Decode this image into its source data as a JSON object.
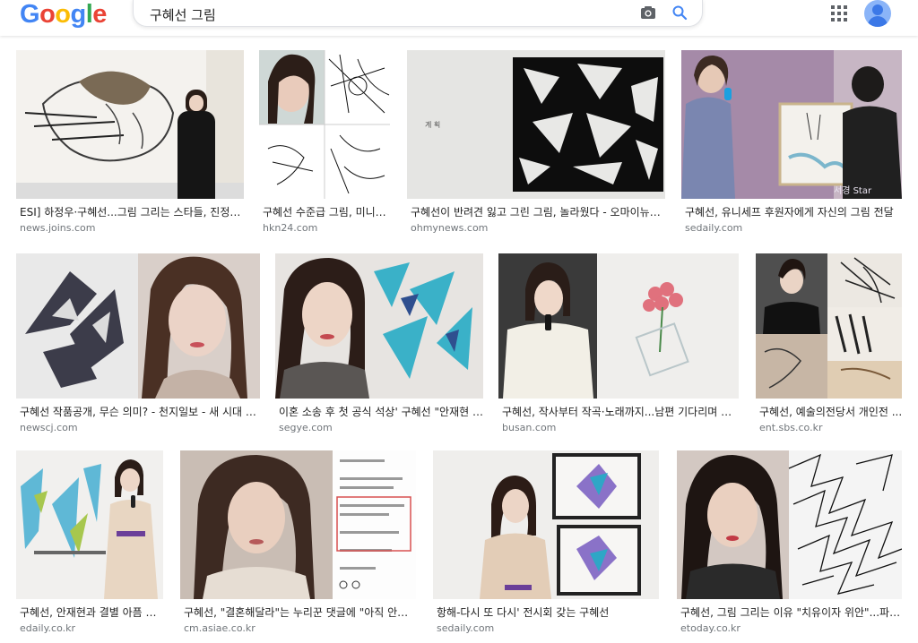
{
  "header": {
    "logo": [
      "G",
      "o",
      "o",
      "g",
      "l",
      "e"
    ],
    "logo_colors": [
      "#4285F4",
      "#EA4335",
      "#FBBC05",
      "#4285F4",
      "#34A853",
      "#EA4335"
    ],
    "search_query": "구혜선 그림",
    "icons": [
      "camera-icon",
      "search-icon",
      "apps-grid-icon",
      "account-avatar-icon"
    ]
  },
  "results": [
    {
      "title": "ESI] 하정우·구혜선...그림 그리는 스타들, 진정 실...",
      "domain": "news.joins.com"
    },
    {
      "title": "구혜선 수준급 그림, 미니홈...",
      "domain": "hkn24.com"
    },
    {
      "title": "구혜선이 반려견 잃고 그린 그림, 놀라웠다 - 오마이뉴스 ...",
      "domain": "ohmynews.com"
    },
    {
      "title": "구혜선, 유니세프 후원자에게 자신의 그림 전달",
      "domain": "sedaily.com"
    },
    {
      "title": "구혜선 작품공개, 무슨 의미? - 천지일보 - 새 시대 희망...",
      "domain": "newscj.com"
    },
    {
      "title": "이혼 소송 후 첫 공식 석상' 구혜선 \"안재현 잊...",
      "domain": "segye.com"
    },
    {
      "title": "구혜선, 작사부터 작곡·노래까지...남편 기다리며 만든 ...",
      "domain": "busan.com"
    },
    {
      "title": "구혜선, 예술의전당서 개인전 ...",
      "domain": "ent.sbs.co.kr"
    },
    {
      "title": "구혜선, 안재현과 결별 아픔 딛...",
      "domain": "edaily.co.kr"
    },
    {
      "title": "구혜선, \"결혼해달라\"는 누리꾼 댓글에 \"아직 안돼\" - ...",
      "domain": "cm.asiae.co.kr"
    },
    {
      "title": "항해-다시 또 다시' 전시회 갖는 구혜선",
      "domain": "sedaily.com"
    },
    {
      "title": "구혜선, 그림 그리는 이유 \"치유이자 위안\"...파리...",
      "domain": "etoday.co.kr"
    }
  ],
  "image_text": {
    "r1c3_label": "계 획",
    "watermark": "서경 Star"
  }
}
